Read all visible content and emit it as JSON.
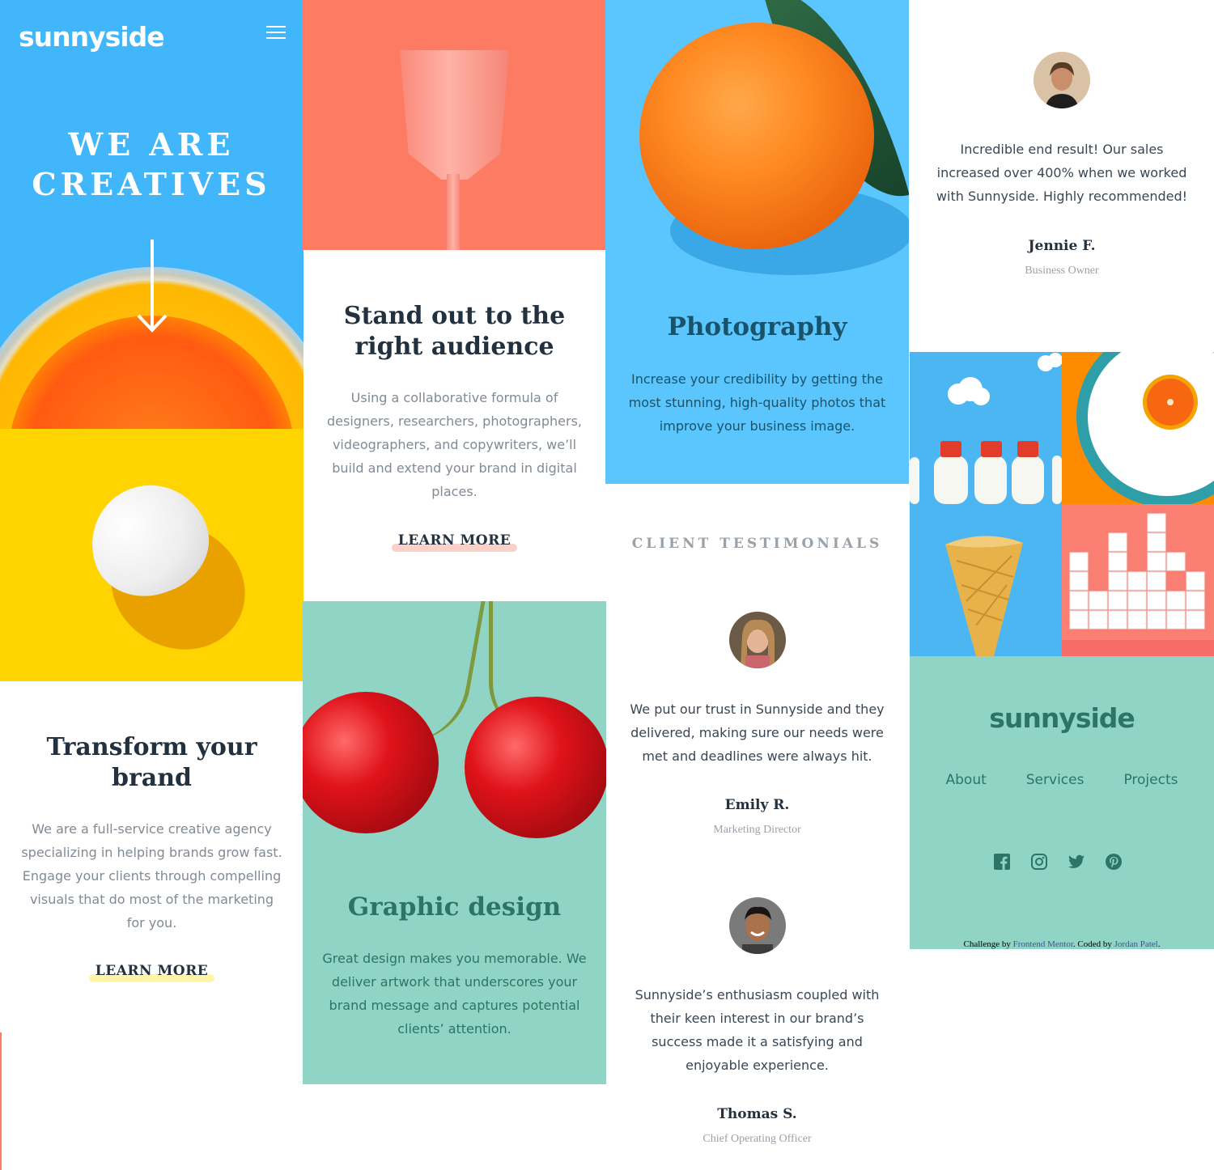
{
  "header": {
    "logo": "sunnyside",
    "menu_icon": "hamburger-icon"
  },
  "hero": {
    "title_line1": "WE ARE",
    "title_line2": "CREATIVES",
    "arrow_icon": "arrow-down-icon"
  },
  "transform": {
    "title": "Transform your brand",
    "text": "We are a full-service creative agency specializing in helping brands grow fast. Engage your clients through compelling visuals that do most of the marketing for you.",
    "cta": "LEARN MORE",
    "cta_highlight_color": "#fef5a8"
  },
  "standout": {
    "title": "Stand out to the right audience",
    "text": "Using a collaborative formula of designers, researchers, photographers, videographers, and copywriters, we’ll build and extend your brand in digital places.",
    "cta": "LEARN MORE",
    "cta_highlight_color": "#fad1c8"
  },
  "graphic_design": {
    "title": "Graphic design",
    "text": "Great design makes you memorable. We deliver artwork that underscores your brand message and captures potential clients’ attention.",
    "title_color": "#2c7566",
    "text_color": "#2c7566"
  },
  "photography": {
    "title": "Photography",
    "text": "Increase your credibility by getting the most stunning, high-quality photos that improve your business image.",
    "title_color": "#19536b",
    "text_color": "#19536b"
  },
  "testimonials": {
    "label": "CLIENT TESTIMONIALS",
    "items": [
      {
        "quote": "We put our trust in Sunnyside and they delivered, making sure our needs were met and deadlines were always hit.",
        "name": "Emily R.",
        "role": "Marketing Director"
      },
      {
        "quote": "Sunnyside’s enthusiasm coupled with their keen interest in our brand’s success made it a satisfying and enjoyable experience.",
        "name": "Thomas S.",
        "role": "Chief Operating Officer"
      },
      {
        "quote": "Incredible end result! Our sales increased over 400% when we worked with Sunnyside. Highly recommended!",
        "name": "Jennie F.",
        "role": "Business Owner"
      }
    ]
  },
  "gallery": {
    "tiles": [
      "milk-bottles",
      "orange-plate",
      "ice-cream-cone",
      "sugar-cubes"
    ]
  },
  "footer": {
    "logo": "sunnyside",
    "nav": [
      "About",
      "Services",
      "Projects"
    ],
    "social": [
      "facebook-icon",
      "instagram-icon",
      "twitter-icon",
      "pinterest-icon"
    ],
    "attribution_prefix": "Challenge by",
    "attribution_link1": "Frontend Mentor",
    "attribution_middle": ". Coded by",
    "attribution_link2": "Jordan Patel",
    "attribution_suffix": "."
  },
  "colors": {
    "brand_blue": "#41b6fb",
    "brand_yellow": "#ffd400",
    "brand_coral": "#fe7b63",
    "brand_teal": "#90d4c5",
    "photo_blue": "#5bc6fd",
    "dark_text": "#23303e",
    "muted_text": "#818a95"
  }
}
